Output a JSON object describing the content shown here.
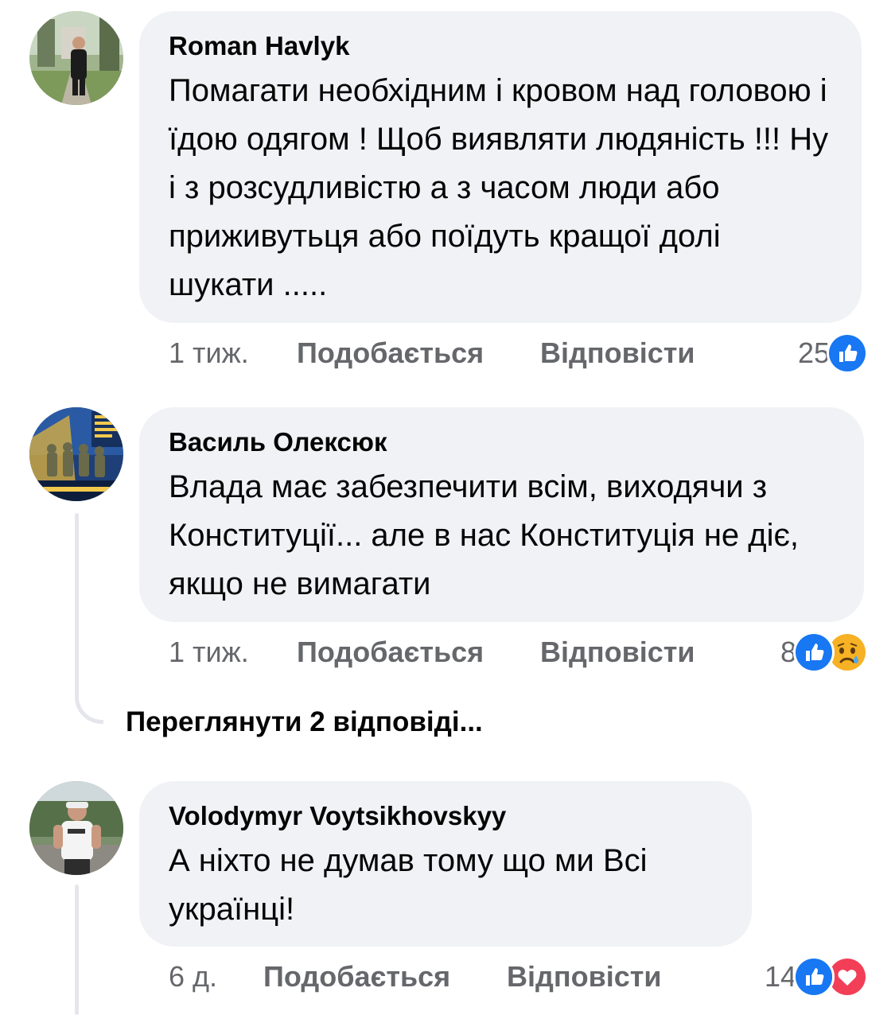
{
  "comments": [
    {
      "author": "Roman Havlyk",
      "text": "Помагати необхідним і кровом над головою і їдою одягом  ! Щоб виявляти людяність !!! Ну і з розсудливістю а з часом люди або приживутьця або поїдуть кращої долі шукати .....",
      "time": "1 тиж.",
      "like_label": "Подобається",
      "reply_label": "Відповісти",
      "reaction_count": "25",
      "reactions": [
        "like-icon"
      ]
    },
    {
      "author": "Василь Олексюк",
      "text": "Влада має забезпечити всім, виходячи з Конституції... але в нас Конституція не діє, якщо не вимагати",
      "time": "1 тиж.",
      "like_label": "Подобається",
      "reply_label": "Відповісти",
      "reaction_count": "8",
      "reactions": [
        "like-icon",
        "sad-icon"
      ],
      "view_replies": "Переглянути 2 відповіді..."
    },
    {
      "author": "Volodymyr Voytsikhovskyy",
      "text": "А ніхто не думав тому що ми Всі українці!",
      "time": "6 д.",
      "like_label": "Подобається",
      "reply_label": "Відповісти",
      "reaction_count": "14",
      "reactions": [
        "like-icon",
        "love-icon"
      ]
    }
  ],
  "colors": {
    "bubble_bg": "#f0f2f5",
    "meta_text": "#65676b",
    "like_blue": "#1877f2",
    "love_red": "#f33e58",
    "sad_yellow": "#f7b125"
  }
}
